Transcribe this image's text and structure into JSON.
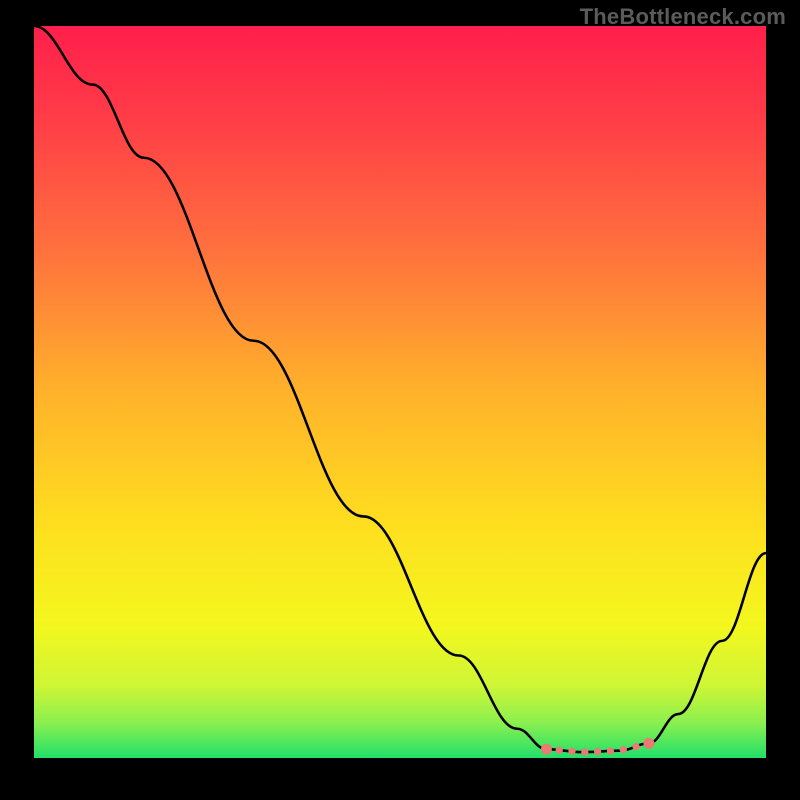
{
  "watermark": "TheBottleneck.com",
  "chart_data": {
    "type": "line",
    "title": "",
    "xlabel": "",
    "ylabel": "",
    "xlim": [
      0,
      100
    ],
    "ylim": [
      0,
      100
    ],
    "grid": false,
    "curve_points": [
      {
        "x": 0,
        "y": 100
      },
      {
        "x": 8,
        "y": 92
      },
      {
        "x": 15,
        "y": 82
      },
      {
        "x": 30,
        "y": 57
      },
      {
        "x": 45,
        "y": 33
      },
      {
        "x": 58,
        "y": 14
      },
      {
        "x": 66,
        "y": 4
      },
      {
        "x": 70,
        "y": 1.2
      },
      {
        "x": 75,
        "y": 0.8
      },
      {
        "x": 80,
        "y": 1.0
      },
      {
        "x": 84,
        "y": 2.0
      },
      {
        "x": 88,
        "y": 6
      },
      {
        "x": 94,
        "y": 16
      },
      {
        "x": 100,
        "y": 28
      }
    ],
    "marker_region": {
      "x_start": 70,
      "x_end": 84,
      "color": "#eb7a74"
    },
    "gradient_stops": [
      {
        "pos": 0.0,
        "color": "#ff1f4b"
      },
      {
        "pos": 0.12,
        "color": "#ff3b47"
      },
      {
        "pos": 0.3,
        "color": "#ff6f3e"
      },
      {
        "pos": 0.5,
        "color": "#ffb22a"
      },
      {
        "pos": 0.68,
        "color": "#ffde1f"
      },
      {
        "pos": 0.82,
        "color": "#f3f71e"
      },
      {
        "pos": 0.9,
        "color": "#cff635"
      },
      {
        "pos": 0.95,
        "color": "#8ef04e"
      },
      {
        "pos": 1.0,
        "color": "#20e06a"
      }
    ]
  }
}
